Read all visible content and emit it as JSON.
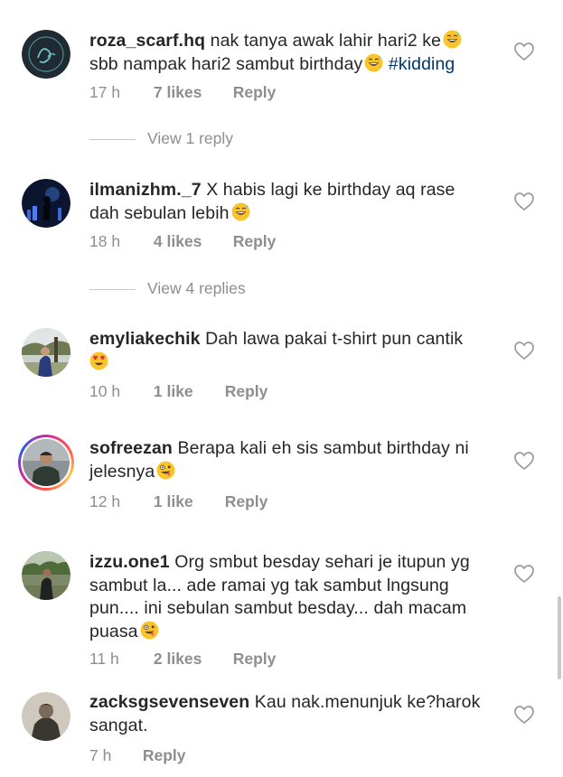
{
  "comments": [
    {
      "username": "roza_scarf.hq",
      "text_1": "nak tanya awak lahir hari2 ke",
      "text_2": "sbb nampak hari2 sambut birthday",
      "hashtag": "#kidding",
      "emojis": [
        "grinning-sweat-emoji",
        "grinning-sweat-emoji"
      ],
      "time": "17 h",
      "likes": "7 likes",
      "reply": "Reply",
      "view_replies": "View 1 reply"
    },
    {
      "username": "ilmanizhm._7",
      "text_1": "X habis lagi ke birthday aq rase",
      "text_2": "dah sebulan lebih",
      "emojis": [
        "grinning-sweat-emoji"
      ],
      "time": "18 h",
      "likes": "4 likes",
      "reply": "Reply",
      "view_replies": "View 4 replies"
    },
    {
      "username": "emyliakechik",
      "text_1": "Dah lawa pakai t-shirt pun cantik",
      "emojis": [
        "heart-eyes-emoji"
      ],
      "time": "10 h",
      "likes": "1 like",
      "reply": "Reply"
    },
    {
      "username": "sofreezan",
      "text_1": "Berapa kali eh sis sambut birthday ni",
      "text_2": "jelesnya",
      "emojis": [
        "zany-face-emoji"
      ],
      "time": "12 h",
      "likes": "1 like",
      "reply": "Reply"
    },
    {
      "username": "izzu.one1",
      "text_1": "Org smbut besday sehari je itupun yg",
      "text_2": "sambut la... ade ramai yg tak sambut lngsung",
      "text_3": "pun.... ini sebulan sambut besday... dah macam",
      "text_4": "puasa",
      "emojis": [
        "zany-face-emoji"
      ],
      "time": "11 h",
      "likes": "2 likes",
      "reply": "Reply"
    },
    {
      "username": "zacksgsevenseven",
      "text_1": "Kau nak.menunjuk ke?harok",
      "text_2": "sangat.",
      "time": "7 h",
      "reply": "Reply"
    }
  ],
  "icons": {
    "like": "heart-outline-icon"
  },
  "colors": {
    "text": "#262626",
    "muted": "#8e8e8e",
    "hashtag": "#00376b"
  }
}
